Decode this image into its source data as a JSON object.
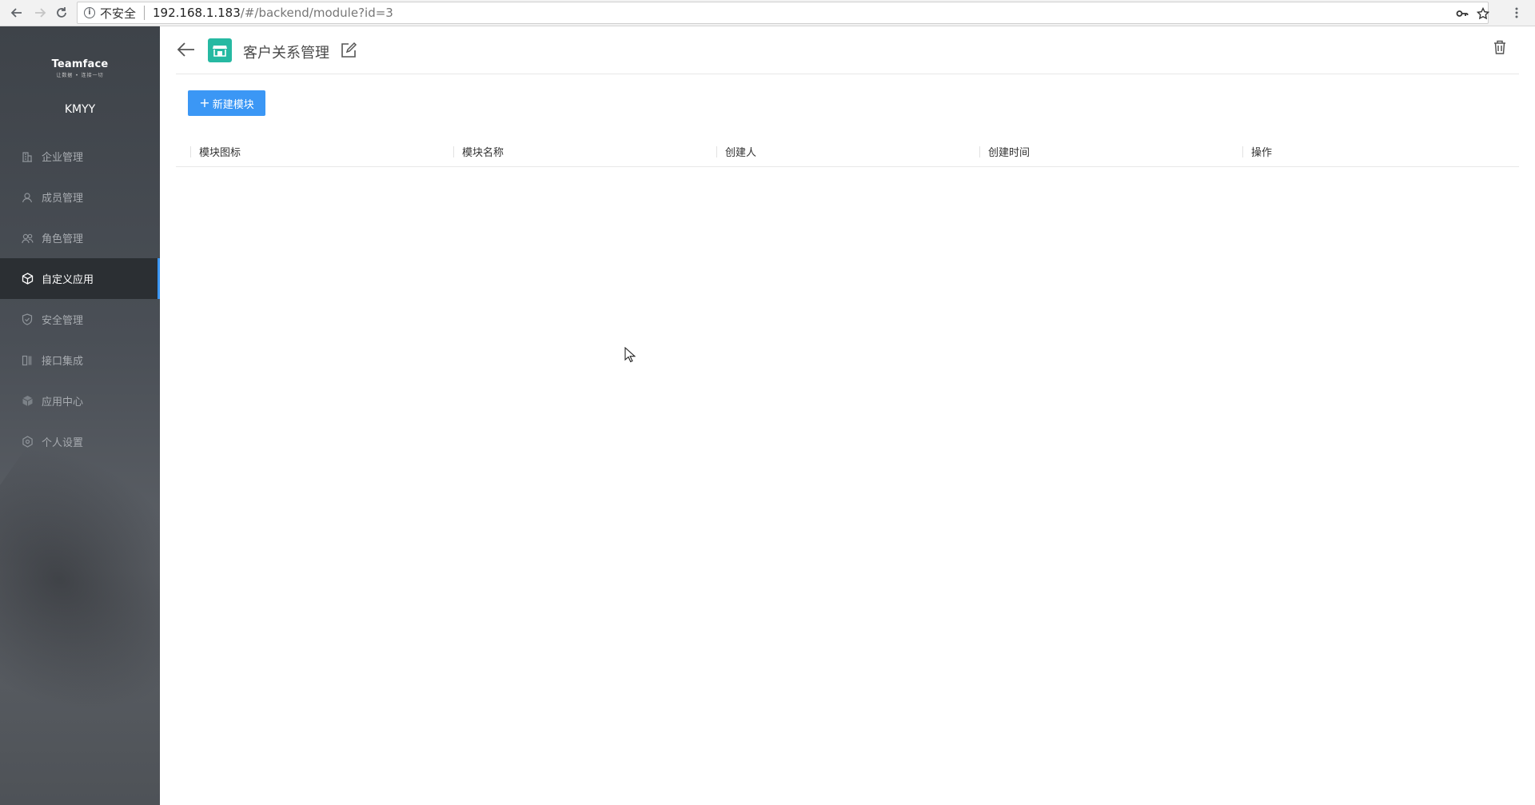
{
  "browser": {
    "insecure_label": "不安全",
    "url_host": "192.168.1.183",
    "url_path": "/#/backend/module?id=3"
  },
  "sidebar": {
    "logo_title": "Teamface",
    "logo_subtitle": "让数据 • 连接一切",
    "company": "KMYY",
    "items": [
      {
        "label": "企业管理",
        "icon": "building-icon"
      },
      {
        "label": "成员管理",
        "icon": "member-icon"
      },
      {
        "label": "角色管理",
        "icon": "role-icon"
      },
      {
        "label": "自定义应用",
        "icon": "cube-icon",
        "active": true
      },
      {
        "label": "安全管理",
        "icon": "shield-icon"
      },
      {
        "label": "接口集成",
        "icon": "interface-icon"
      },
      {
        "label": "应用中心",
        "icon": "app-center-icon"
      },
      {
        "label": "个人设置",
        "icon": "settings-icon"
      }
    ]
  },
  "header": {
    "title": "客户关系管理",
    "app_icon": "store-icon",
    "app_icon_color": "#26b9a2"
  },
  "toolbar": {
    "new_module_label": "新建模块",
    "accent_color": "#3b97f5"
  },
  "table": {
    "columns": [
      "模块图标",
      "模块名称",
      "创建人",
      "创建时间",
      "操作"
    ],
    "rows": []
  }
}
